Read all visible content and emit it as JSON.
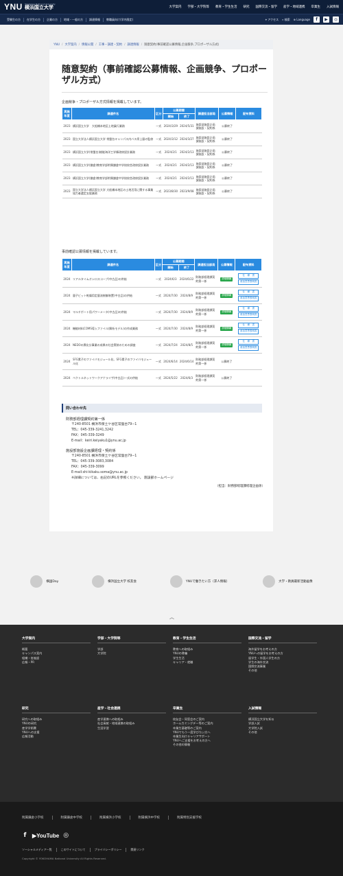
{
  "header": {
    "logo": "YNU",
    "tagline": "Yokohama National University",
    "name_ja": "横浜国立大学",
    "nav": [
      "大学案内",
      "学部・大学院等",
      "教育・学生生活",
      "研究",
      "国際交流・留学",
      "産学・地域連携",
      "卒業生",
      "入試情報"
    ]
  },
  "subnav": {
    "left": [
      "受験生の方",
      "在学生の方",
      "企業の方",
      "地域・一般の方",
      "調達情報",
      "教職員向け(学内限定)"
    ],
    "access": "アクセス",
    "search": "検索",
    "language": "Language"
  },
  "breadcrumb": [
    "YNU",
    "大学案内",
    "情報公開",
    "工事・調達・契約",
    "調達情報",
    "随意契約(事前確認公募情報,企画競争,プロポーザル方式)"
  ],
  "page_title": "随意契約（事前確認公募情報、企画競争、プロポーザル方式）",
  "section1": {
    "lead": "企画競争・プロポーザル方式情報を掲載しています。",
    "headers": [
      "実施年度",
      "調達件名",
      "区分",
      "公募期間",
      "開始",
      "終了",
      "調達担当部局",
      "公募情報",
      "配布資料"
    ],
    "rows": [
      [
        "2023",
        "横浜国立大学　大船橋本地区土地乗行業務",
        "一式",
        "2024/3/29",
        "2024/5/31",
        "施設部施設企画課施設・契約係",
        "公募終了"
      ],
      [
        "2023",
        "国立大学法人横浜国立大学 常盤台キャンパス内バス停上屋の監修",
        "一式",
        "2024/3/12",
        "2024/3/27",
        "施設部施設企画課施設・契約係",
        "公募終了"
      ],
      [
        "2023",
        "横浜国立大学(常盤台)総能海洋工学棟改修設計業務",
        "一式",
        "2024/2/1",
        "2024/2/13",
        "施設部施設企画課施設・契約係",
        "公募終了"
      ],
      [
        "2023",
        "横浜国立大学(鎌倉)教育学部附属鎌倉中学校校舎改修設計業務",
        "一式",
        "2024/2/1",
        "2024/2/13",
        "施設部施設企画課施設・契約係",
        "公募終了"
      ],
      [
        "2023",
        "横浜国立大学(鎌倉)教育学部附属鎌倉中学校校舎改修設計業務",
        "一式",
        "2024/2/1",
        "2024/2/13",
        "施設部施設企画課施設・契約係",
        "公募終了"
      ],
      [
        "2023",
        "国立大学法人横浜国立大学 大船橋本地区の土地活用に関する事業協力者選定支援業務",
        "一式",
        "2023/8/30",
        "2023/9/08",
        "施設部施設企画課施設・契約係",
        "公募終了"
      ]
    ]
  },
  "section2": {
    "lead": "事前確認公募情報を掲載しています。",
    "btn_spec": "仕　様　書",
    "btn_apply": "参加意思表明書",
    "rows": [
      [
        "2024",
        "リアルタイムオシロスコープ(中古品)の供給",
        "一式",
        "2024/6/3",
        "2024/6/22",
        "財務部経理課契約第一係",
        "詳細情報"
      ],
      [
        "2024",
        "量子ビット乾燥用定量流制御装置(中古品)の供給",
        "一式",
        "2024/7/30",
        "2024/8/9",
        "財務部経理課契約第一係",
        "詳細情報"
      ],
      [
        "2024",
        "マルチポート用パワーメータ(中古品)の供給",
        "一式",
        "2024/7/30",
        "2024/8/9",
        "財務部経理課契約第一係",
        "詳細情報"
      ],
      [
        "2024",
        "機能材料COMS導入ファイル(解析モデル)の作成業務",
        "一式",
        "2024/7/30",
        "2024/8/9",
        "財務部経理課契約第一係",
        "詳細情報"
      ],
      [
        "2024",
        "NEDOの異化分事業の成果の社会実装のための調査",
        "一式",
        "2024/7/24",
        "2024/8/5",
        "財務部経理課契約第一係",
        "詳細情報"
      ],
      [
        "2024",
        "SFG素子のファイバモジュール化、SFG素子のファイバモジュール化",
        "一式",
        "2024/6/14",
        "2024/6/14",
        "財務部経理課契約第一係",
        "公募終了"
      ],
      [
        "2024",
        "ベクトルネットワークアナライザ(中古品)一式の供給",
        "一式",
        "2024/5/22",
        "2024/6/3",
        "財務部経理課契約第一係",
        "公募終了"
      ]
    ]
  },
  "contact": {
    "title": "問い合わせ先",
    "b1": {
      "head": "財務部経理課契約第一係",
      "lines": [
        "〒240-8501 横浜市保土ケ谷区常盤台79−1",
        "TEL：045-339-3241,3242",
        "FAX：045-339-3249",
        "E-mail：keiri.keiyaku1@ynu.ac.jp"
      ]
    },
    "b2": {
      "head": "施設部施設企画課経理・契約係",
      "lines": [
        "〒240-8501 横浜市保土ケ谷区常盤台79−1",
        "TEL：045-339-3083,3084",
        "FAX：045-339-3099",
        "E-mail:shi-kikaku.soma@ynu.ac.jp",
        "※詳細については、右記のURLを参照ください。 施設部ホームページ"
      ]
    },
    "note": "（担当：財務部経理課経理企画係）"
  },
  "banners": [
    "横国Day",
    "横浜国立大学 校友会",
    "YNUで働きたい方（求人情報）",
    "大学・教員最新活動画像"
  ],
  "footer": {
    "cols": [
      {
        "h": "大学案内",
        "items": [
          "概要",
          "キャンパス案内",
          "組織・各施設",
          "広報・PR"
        ]
      },
      {
        "h": "学部・大学院等",
        "items": [
          "学部",
          "大学院"
        ]
      },
      {
        "h": "教育・学生生活",
        "items": [
          "教育への取組み",
          "YNUの教養",
          "学生生活",
          "キャリア・就職"
        ]
      },
      {
        "h": "国際交流・留学",
        "items": [
          "海外留学をお考えの方",
          "YNUへの留学をお考えの方",
          "留学生・外国人学生の方",
          "学生の海外交流",
          "国際交流事業",
          "その他"
        ]
      },
      {
        "h": "研究",
        "items": [
          "研究への取組み",
          "YNUの研究",
          "産学学術費",
          "YNUへの支援",
          "広報活動"
        ]
      },
      {
        "h": "産学・社会連携",
        "items": [
          "産学連携への取組み",
          "社会貢献・地域連携の取組み",
          "生涯学習"
        ]
      },
      {
        "h": "卒業生",
        "items": [
          "校友会・同窓会のご案内",
          "ホームカミングデー等のご案内",
          "卒業生基礎等のご案内",
          "YNUでもう一度学びたい方へ",
          "卒業生向けキャリアサポート",
          "YNUへご支援をお考えの方へ",
          "その他の情報"
        ]
      },
      {
        "h": "入試情報",
        "items": [
          "横浜国立大学を知る",
          "学部入試",
          "大学院入試",
          "その他"
        ]
      }
    ],
    "schools": [
      "附属鎌倉小学校",
      "附属鎌倉中学校",
      "附属横浜小学校",
      "附属横浜中学校",
      "附属特別支援学校"
    ],
    "links": [
      "ソーシャルメディア一覧",
      "このサイトについて",
      "プライバシーポリシー",
      "関連リンク"
    ],
    "copyright": "Copyright © YOKOHAMA National University All Rights Reserved."
  }
}
